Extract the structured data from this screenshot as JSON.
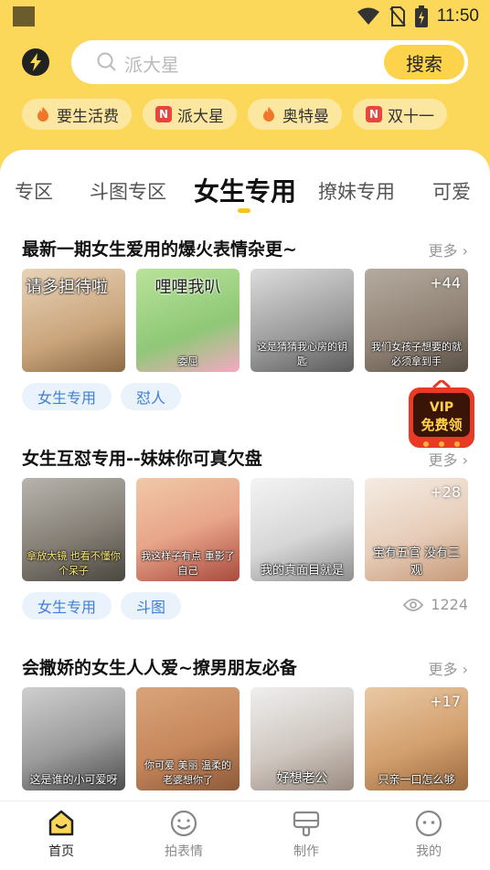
{
  "status_bar": {
    "time": "11:50"
  },
  "search": {
    "placeholder": "派大星",
    "button_label": "搜索"
  },
  "hot_chips": [
    {
      "label": "要生活费",
      "icon": "fire-icon"
    },
    {
      "label": "派大星",
      "icon": "new-badge-icon",
      "badge": "N"
    },
    {
      "label": "奥特曼",
      "icon": "fire-icon"
    },
    {
      "label": "双十一",
      "icon": "new-badge-icon",
      "badge": "N"
    }
  ],
  "tabs": [
    "专区",
    "斗图专区",
    "女生专用",
    "撩妹专用",
    "可爱"
  ],
  "active_tab": "女生专用",
  "sections": [
    {
      "title": "最新一期女生爱用的爆火表情杂更~",
      "more_label": "更多",
      "images": [
        {
          "caption_top": "请多担待啦",
          "caption": ""
        },
        {
          "caption_top": "哩哩我叭",
          "caption": "委屈"
        },
        {
          "caption_top": "",
          "caption": "这是猜猜我心房的钥匙"
        },
        {
          "caption_top": "",
          "caption": "我们女孩子想要的就必须拿到手"
        }
      ],
      "more_count": "+44",
      "tags": [
        "女生专用",
        "怼人"
      ]
    },
    {
      "title": "女生互怼专用--妹妹你可真欠盘",
      "more_label": "更多",
      "images": [
        {
          "caption_top": "",
          "caption": "拿放大镜 也看不懂你个呆子"
        },
        {
          "caption_top": "",
          "caption": "我这样子有点 重影了自己"
        },
        {
          "caption_top": "",
          "caption": "我的真面目就是"
        },
        {
          "caption_top": "",
          "caption": "宝有五官 没有三观"
        }
      ],
      "more_count": "+28",
      "tags": [
        "女生专用",
        "斗图"
      ],
      "views": "1224"
    },
    {
      "title": "会撒娇的女生人人爱~撩男朋友必备",
      "more_label": "更多",
      "images": [
        {
          "caption_top": "",
          "caption": "这是谁的小可爱呀"
        },
        {
          "caption_top": "",
          "caption": "你可爱 美丽 温柔的 老婆想你了"
        },
        {
          "caption_top": "",
          "caption": "好想老公"
        },
        {
          "caption_top": "",
          "caption": "只亲一口怎么够"
        }
      ],
      "more_count": "+17"
    }
  ],
  "vip_badge": {
    "line1": "VIP",
    "line2": "免费领"
  },
  "bottom_nav": [
    {
      "label": "首页",
      "icon": "home-icon",
      "active": true
    },
    {
      "label": "拍表情",
      "icon": "smiley-icon",
      "active": false
    },
    {
      "label": "制作",
      "icon": "make-icon",
      "active": false
    },
    {
      "label": "我的",
      "icon": "profile-icon",
      "active": false
    }
  ],
  "colors": {
    "accent": "#fcd85a",
    "button": "#fcd34a",
    "tag_text": "#3d7fd6",
    "tag_bg": "#eaf2fc"
  }
}
